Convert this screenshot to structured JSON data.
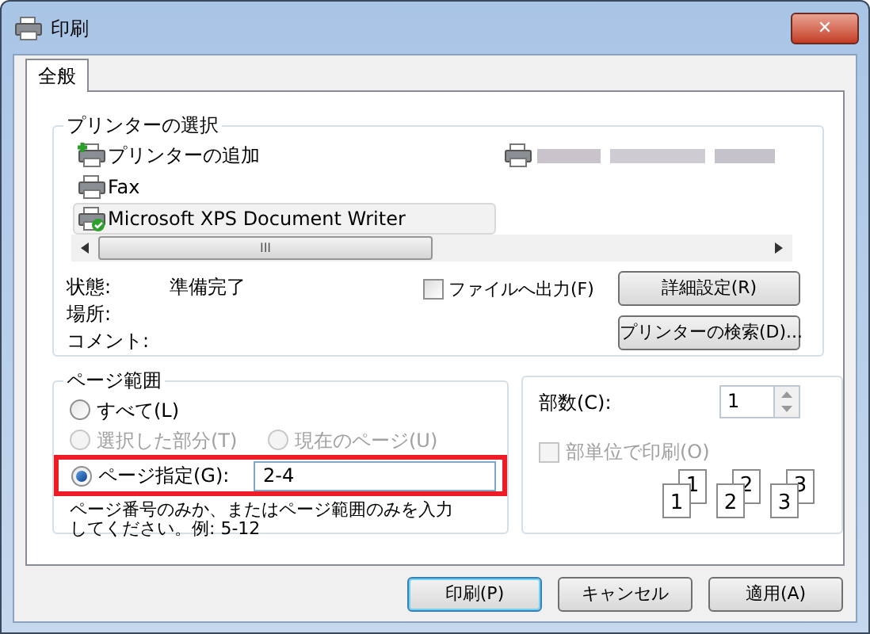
{
  "window": {
    "title": "印刷",
    "close": "✕"
  },
  "tabs": [
    {
      "label": "全般",
      "selected": true
    }
  ],
  "printer_group": {
    "title": "プリンターの選択",
    "printers": [
      {
        "kind": "add",
        "name": "プリンターの追加",
        "selected": false
      },
      {
        "kind": "obscured",
        "selected": false
      },
      {
        "kind": "fax",
        "name": "Fax",
        "selected": false
      },
      {
        "kind": "xps",
        "name": "Microsoft XPS Document Writer",
        "selected": true
      }
    ],
    "scroll_grip": "III",
    "status_label": "状態:",
    "status_value": "準備完了",
    "location_label": "場所:",
    "comment_label": "コメント:",
    "print_to_file": {
      "label": "ファイルへ出力(F)",
      "checked": false
    },
    "buttons": [
      "詳細設定(R)",
      "プリンターの検索(D)..."
    ]
  },
  "page_range": {
    "title": "ページ範囲",
    "options": [
      {
        "label": "すべて(L)",
        "selected": false,
        "disabled": false
      },
      {
        "label": "選択した部分(T)",
        "selected": false,
        "disabled": true
      },
      {
        "label": "現在のページ(U)",
        "selected": false,
        "disabled": true
      },
      {
        "label": "ページ指定(G):",
        "selected": true,
        "disabled": false,
        "highlighted": true
      }
    ],
    "pages_value": "2-4",
    "hint": "ページ番号のみか、またはページ範囲のみを入力してください。例: 5-12"
  },
  "copies": {
    "label": "部数(C):",
    "value": "1",
    "collate": {
      "label": "部単位で印刷(O)",
      "checked": false,
      "disabled": true
    },
    "stacks": [
      {
        "front": "1",
        "back": "1"
      },
      {
        "front": "2",
        "back": "2"
      },
      {
        "front": "3",
        "back": "3"
      }
    ]
  },
  "dialog_buttons": [
    {
      "label": "印刷(P)",
      "default": true
    },
    {
      "label": "キャンセル",
      "default": false
    },
    {
      "label": "適用(A)",
      "default": false
    }
  ]
}
